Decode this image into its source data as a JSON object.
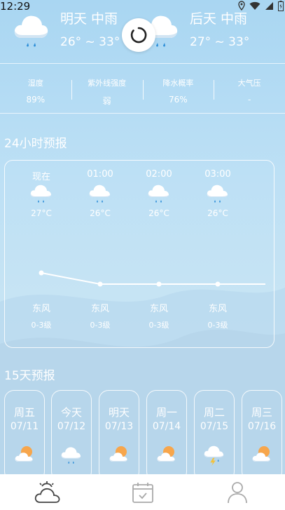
{
  "status_bar": {
    "time": "12:29",
    "icons": [
      "location-icon",
      "wifi-icon",
      "signal-icon",
      "battery-icon"
    ]
  },
  "top_forecast": [
    {
      "title": "明天 中雨",
      "temp": "26° ~ 33°",
      "icon": "rain-cloud-icon"
    },
    {
      "title": "后天 中雨",
      "temp": "27° ~ 33°",
      "icon": "rain-cloud-icon"
    }
  ],
  "stats": [
    {
      "label": "湿度",
      "value": "89%"
    },
    {
      "label": "紫外线强度",
      "value": "弱"
    },
    {
      "label": "降水概率",
      "value": "76%"
    },
    {
      "label": "大气压",
      "value": "-"
    }
  ],
  "hourly": {
    "title": "24小时预报",
    "items": [
      {
        "time": "现在",
        "icon": "rain-cloud-icon",
        "temp": "27°C",
        "temp_value": 27,
        "wind": "东风",
        "level": "0-3级"
      },
      {
        "time": "01:00",
        "icon": "rain-cloud-icon",
        "temp": "26°C",
        "temp_value": 26,
        "wind": "东风",
        "level": "0-3级"
      },
      {
        "time": "02:00",
        "icon": "rain-cloud-icon",
        "temp": "26°C",
        "temp_value": 26,
        "wind": "东风",
        "level": "0-3级"
      },
      {
        "time": "03:00",
        "icon": "rain-cloud-icon",
        "temp": "26°C",
        "temp_value": 26,
        "wind": "东风",
        "level": "0-3级"
      }
    ]
  },
  "daily": {
    "title": "15天预报",
    "items": [
      {
        "week": "周五",
        "date": "07/11",
        "icon": "cloud-sun-icon"
      },
      {
        "week": "今天",
        "date": "07/12",
        "icon": "rain-cloud-icon"
      },
      {
        "week": "明天",
        "date": "07/13",
        "icon": "cloud-sun-icon"
      },
      {
        "week": "周一",
        "date": "07/14",
        "icon": "cloud-sun-icon"
      },
      {
        "week": "周二",
        "date": "07/15",
        "icon": "thunder-cloud-icon"
      },
      {
        "week": "周三",
        "date": "07/16",
        "icon": "cloud-sun-icon"
      }
    ]
  },
  "nav": [
    {
      "name": "weather-tab",
      "icon": "cloud-sun-outline-icon",
      "active": true
    },
    {
      "name": "calendar-tab",
      "icon": "calendar-check-icon",
      "active": false
    },
    {
      "name": "profile-tab",
      "icon": "user-icon",
      "active": false
    }
  ]
}
